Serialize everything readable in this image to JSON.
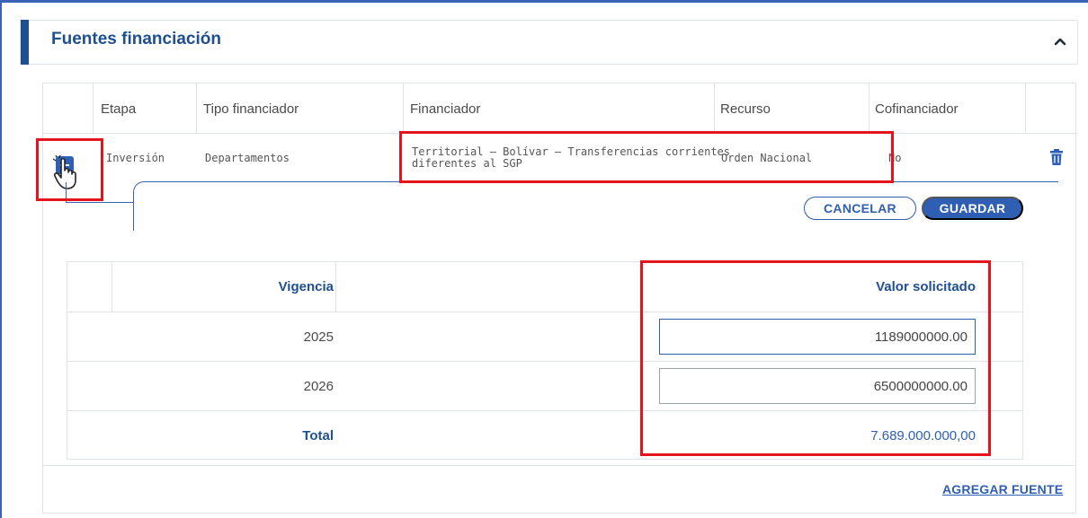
{
  "section": {
    "title": "Fuentes financiación",
    "collapse_icon": "chevron-up-icon"
  },
  "table": {
    "headers": [
      "Etapa",
      "Tipo financiador",
      "Financiador",
      "Recurso",
      "Cofinanciador"
    ],
    "row": {
      "etapa": "Inversión",
      "tipo_financiador": "Departamentos",
      "financiador_line1": "Territorial – Bolívar – Transferencias corrientes",
      "financiador_line2": "diferentes al SGP",
      "recurso": "Orden Nacional",
      "cofinanciador": "No"
    },
    "delete_icon": "trash-icon",
    "expand_icon": "minus-icon"
  },
  "actions": {
    "cancel_label": "CANCELAR",
    "save_label": "GUARDAR"
  },
  "detail": {
    "headers": {
      "vigencia": "Vigencia",
      "valor": "Valor solicitado"
    },
    "rows": [
      {
        "vigencia": "2025",
        "valor": "1189000000.00"
      },
      {
        "vigencia": "2026",
        "valor": "6500000000.00"
      }
    ],
    "total_label": "Total",
    "total_value": "7.689.000.000,00"
  },
  "footer": {
    "add_label": "AGREGAR FUENTE"
  },
  "colors": {
    "primary": "#2f5fb3",
    "title": "#1f4f8f",
    "highlight": "#e5141c",
    "border": "#dfe3ea"
  }
}
